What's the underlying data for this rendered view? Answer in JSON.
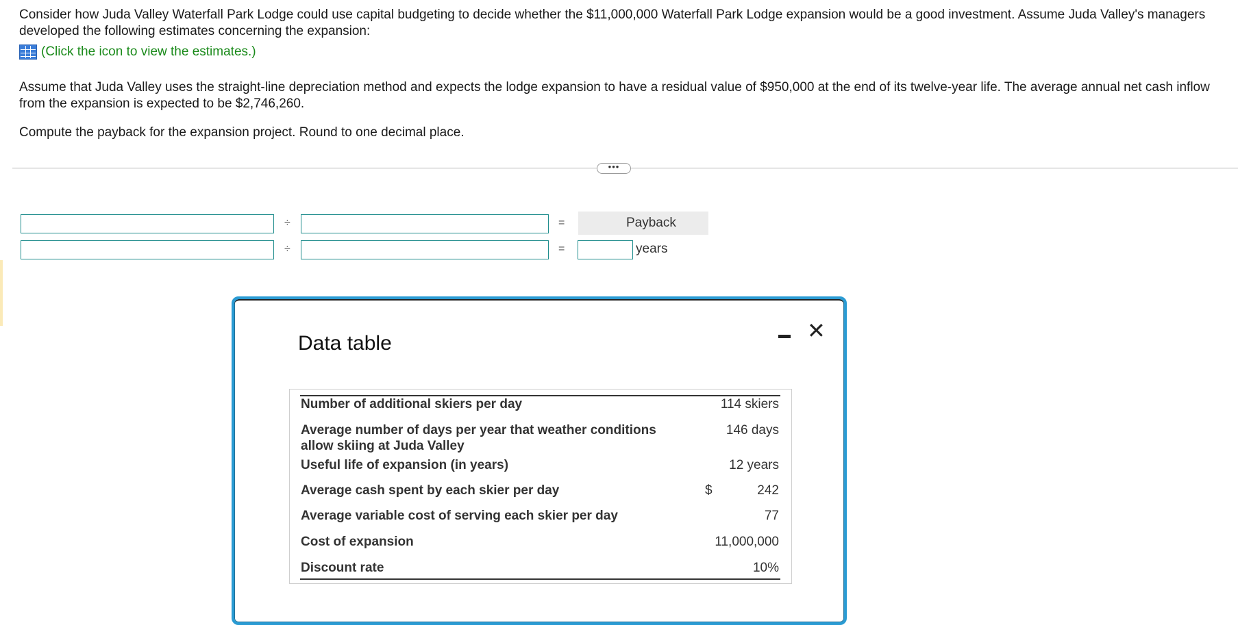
{
  "question": {
    "para1": "Consider how Juda Valley Waterfall Park Lodge could use capital budgeting to decide whether the $11,000,000 Waterfall Park Lodge expansion would be a good investment. Assume Juda Valley's managers developed the following estimates concerning the expansion:",
    "estimates_link": "(Click the icon to view the estimates.)",
    "para2": "Assume that Juda Valley uses the straight-line depreciation method and expects the lodge expansion to have a residual value of $950,000 at the end of its twelve-year life. The average annual net cash inflow from the expansion is expected to be $2,746,260.",
    "para3": "Compute the payback for the expansion project. Round to one decimal place."
  },
  "more_button_label": "•••",
  "formula": {
    "divide_symbol": "÷",
    "equals_symbol": "=",
    "result_header": "Payback",
    "result_unit": "years",
    "row1": {
      "input1": "",
      "input2": ""
    },
    "row2": {
      "input1": "",
      "input2": "",
      "result": ""
    }
  },
  "dialog": {
    "title": "Data table",
    "minimize_icon": "minimize-icon",
    "close_symbol": "✕",
    "rows": [
      {
        "label": "Number of additional skiers per day",
        "currency": "",
        "value": "114 skiers"
      },
      {
        "label": "Average number of days per year that weather conditions allow skiing at Juda Valley",
        "currency": "",
        "value": "146 days"
      },
      {
        "label": "Useful life of expansion (in years)",
        "currency": "",
        "value": "12 years"
      },
      {
        "label": "Average cash spent by each skier per day",
        "currency": "$",
        "value": "242"
      },
      {
        "label": "Average variable cost of serving each skier per day",
        "currency": "",
        "value": "77"
      },
      {
        "label": "Cost of expansion",
        "currency": "",
        "value": "11,000,000"
      },
      {
        "label": "Discount rate",
        "currency": "",
        "value": "10%"
      }
    ]
  },
  "colors": {
    "link_green": "#1a8a1a",
    "input_border": "#1e8c8c",
    "dialog_border": "#2a9bd3"
  }
}
